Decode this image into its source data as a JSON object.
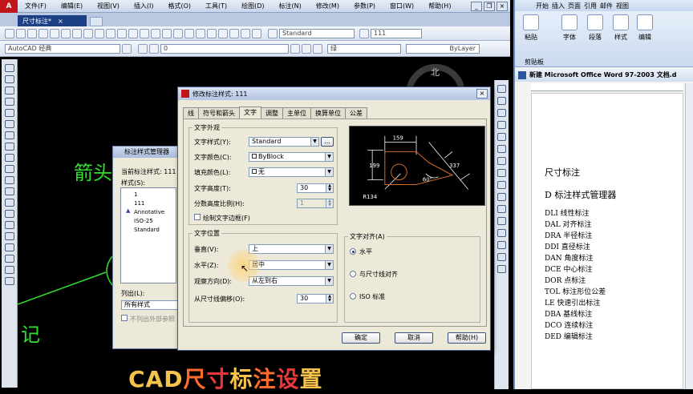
{
  "cad": {
    "menu": [
      "文件(F)",
      "编辑(E)",
      "视图(V)",
      "插入(I)",
      "格式(O)",
      "工具(T)",
      "绘图(D)",
      "标注(N)",
      "修改(M)",
      "参数(P)",
      "窗口(W)",
      "帮助(H)"
    ],
    "doc_tab": "尺寸标注*",
    "doc_tab_close": "×",
    "workspace": "AutoCAD 经典",
    "layer": "0",
    "text_style": "Standard",
    "dim_value": "111",
    "color": "绿",
    "linetype": "ByLayer",
    "compass": "北",
    "drawing_text_1": "箭头",
    "drawing_text_2": "记",
    "accent": "#2fe02f"
  },
  "manager": {
    "title": "标注样式管理器",
    "current_style_label": "当前标注样式: 111",
    "styles_label": "样式(S):",
    "styles": [
      "1",
      "111",
      "Annotative",
      "ISO-25",
      "Standard"
    ],
    "list_label": "列出(L):",
    "list_value": "所有样式",
    "no_xref_label": "不列出外部参照"
  },
  "dialog": {
    "title": "修改标注样式: 111",
    "close": "×",
    "tabs": [
      "线",
      "符号和箭头",
      "文字",
      "调整",
      "主单位",
      "换算单位",
      "公差"
    ],
    "appearance": {
      "group": "文字外观",
      "style_label": "文字样式(Y):",
      "style_value": "Standard",
      "style_more": "...",
      "color_label": "文字颜色(C):",
      "color_value": "ByBlock",
      "fill_label": "填充颜色(L):",
      "fill_value": "无",
      "height_label": "文字高度(T):",
      "height_value": "30",
      "fraction_label": "分数高度比例(H):",
      "fraction_value": "1",
      "frame_label": "绘制文字边框(F)"
    },
    "placement": {
      "group": "文字位置",
      "vertical_label": "垂直(V):",
      "vertical_value": "上",
      "horizontal_label": "水平(Z):",
      "horizontal_value": "居中",
      "view_label": "观察方向(D):",
      "view_value": "从左到右",
      "offset_label": "从尺寸线偏移(O):",
      "offset_value": "30"
    },
    "alignment": {
      "group": "文字对齐(A)",
      "options": [
        "水平",
        "与尺寸线对齐",
        "ISO 标准"
      ],
      "selected": 0
    },
    "preview": {
      "dims": [
        "159",
        "199",
        "337",
        "60°",
        "R134"
      ]
    },
    "buttons": {
      "ok": "确定",
      "cancel": "取消",
      "help": "帮助(H)"
    }
  },
  "banner": {
    "parts": [
      {
        "text": "CAD",
        "color": "#f6c34a"
      },
      {
        "text": "尺",
        "color": "#ff6a2a"
      },
      {
        "text": "寸",
        "color": "#e8383a"
      },
      {
        "text": "标",
        "color": "#f6c34a"
      },
      {
        "text": "注",
        "color": "#ff6a2a"
      },
      {
        "text": "设",
        "color": "#e8383a"
      },
      {
        "text": "置",
        "color": "#f6c34a"
      }
    ]
  },
  "word": {
    "tabs": [
      "开始",
      "插入",
      "页面",
      "引用",
      "邮件",
      "视图"
    ],
    "groups": [
      "粘贴",
      "字体",
      "段落",
      "样式",
      "编辑"
    ],
    "clipboard": "剪贴板",
    "title": "新建 Microsoft Office Word 97-2003 文档.d",
    "lines": [
      "尺寸标注",
      "D  标注样式管理器",
      "DLI 线性标注",
      "DAL 对齐标注",
      "DRA 半径标注",
      "DDI 直径标注",
      "DAN 角度标注",
      "DCE 中心标注",
      "DOR 点标注",
      "TOL 标注形位公差",
      "LE 快速引出标注",
      "DBA 基线标注",
      "DCO 连续标注",
      "DED 编辑标注"
    ]
  }
}
